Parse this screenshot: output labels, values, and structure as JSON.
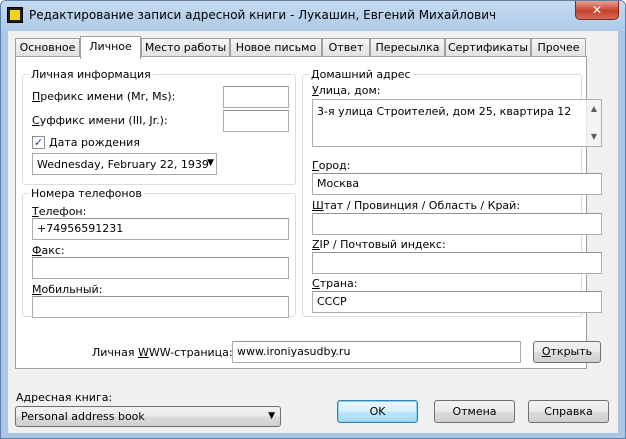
{
  "window": {
    "title": "Редактирование записи адресной книги - Лукашин, Евгений Михайлович",
    "close_label": "✕"
  },
  "tabs": [
    {
      "label": "Основное"
    },
    {
      "label": "Личное",
      "active": true
    },
    {
      "label": "Место работы"
    },
    {
      "label": "Новое письмо"
    },
    {
      "label": "Ответ"
    },
    {
      "label": "Пересылка"
    },
    {
      "label": "Сертификаты"
    },
    {
      "label": "Прочее"
    }
  ],
  "personal": {
    "legend": "Личная информация",
    "prefix_key": "П",
    "prefix_rest": "рефикс имени (Mr, Ms):",
    "prefix_value": "",
    "suffix_key": "С",
    "suffix_rest": "уффикс имени (III, Jr.):",
    "suffix_value": "",
    "birthday_key": "Д",
    "birthday_rest": "ата рождения",
    "birthday_checked": true,
    "birthday_check_glyph": "✓",
    "birthday_value": "Wednesday,   February   22, 1939"
  },
  "phones": {
    "legend": "Номера телефонов",
    "phone_key": "Т",
    "phone_rest": "елефон:",
    "phone_value": "+74956591231",
    "fax_key": "Ф",
    "fax_rest": "акс:",
    "fax_value": "",
    "mobile_key": "М",
    "mobile_rest": "обильный:",
    "mobile_value": ""
  },
  "home": {
    "legend": "Домашний адрес",
    "street_key": "У",
    "street_rest": "лица, дом:",
    "street_value": "3-я улица Строителей, дом 25, квартира 12",
    "city_key": "Г",
    "city_rest": "ород:",
    "city_value": "Москва",
    "state_key": "Ш",
    "state_rest": "тат / Провинция / Область / Край:",
    "state_value": "",
    "zip_key": "Z",
    "zip_rest": "IP / Почтовый индекс:",
    "zip_value": "",
    "country_key": "С",
    "country_rest": "трана:",
    "country_value": "СССР"
  },
  "web": {
    "label_pre": "Личная ",
    "label_key": "W",
    "label_rest": "WW-страница:",
    "value": "www.ironiyasudby.ru",
    "open_key": "О",
    "open_rest": "ткрыть"
  },
  "footer": {
    "addressbook_label": "Адресная книга:",
    "addressbook_value": "Personal address book",
    "ok_label": "OK",
    "cancel_label": "Отмена",
    "help_label": "Справка"
  },
  "icons": {
    "dropdown": "▼",
    "scroll_up": "▲",
    "scroll_down": "▼"
  }
}
